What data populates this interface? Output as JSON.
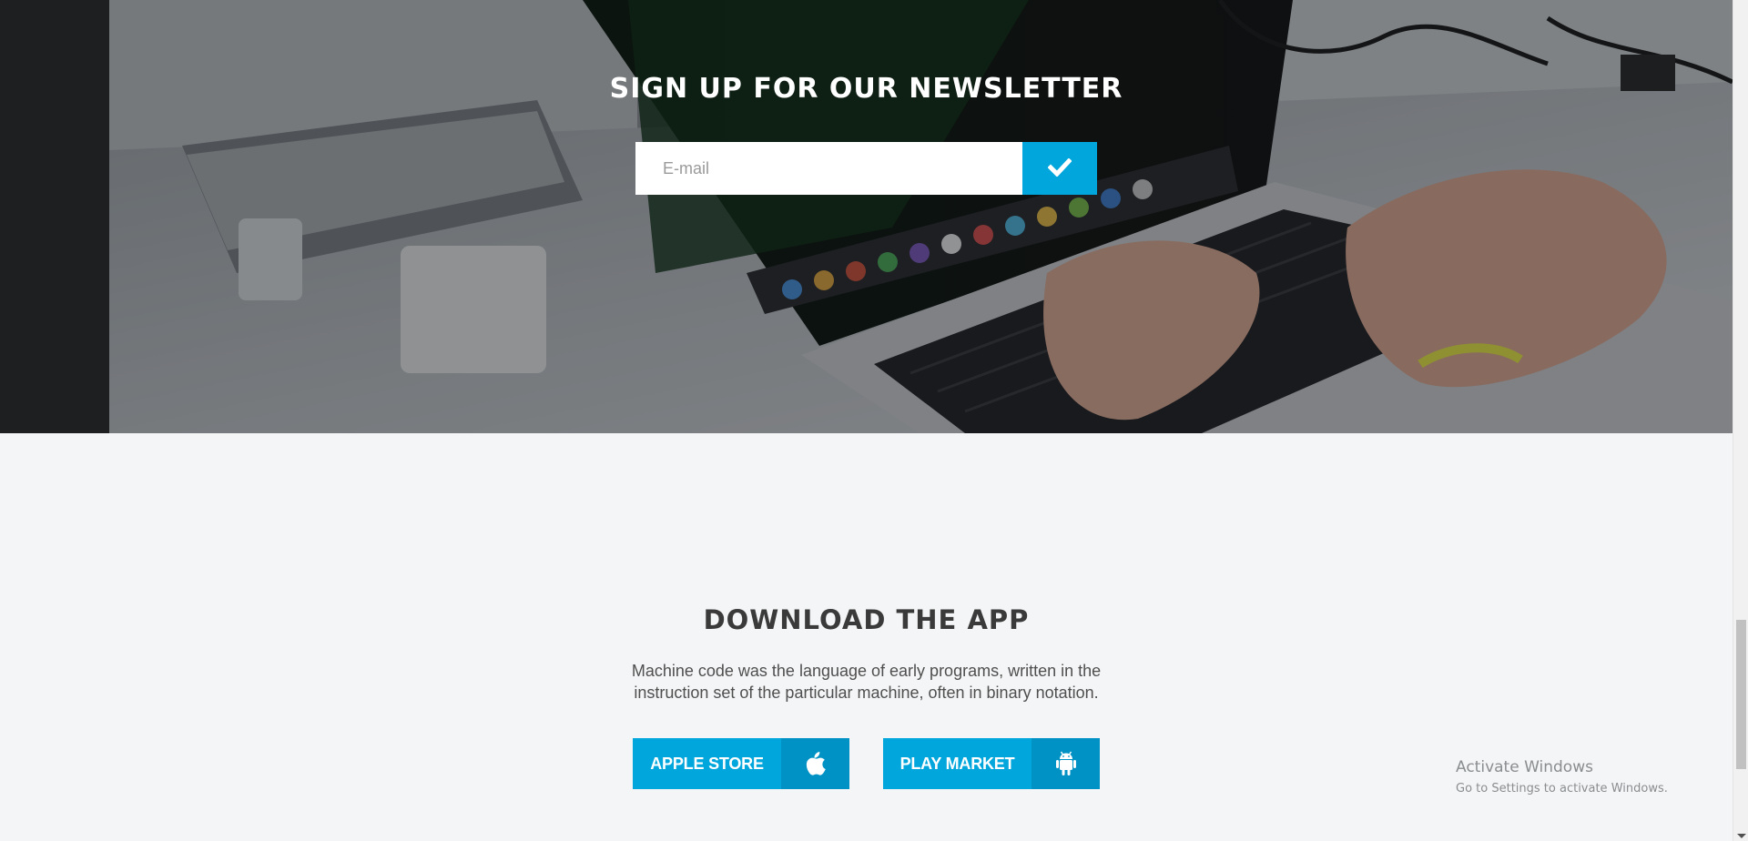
{
  "newsletter": {
    "title": "SIGN UP FOR OUR NEWSLETTER",
    "email_placeholder": "E-mail",
    "submit_icon": "check-icon",
    "background": "laptop-typing-photo"
  },
  "download": {
    "title": "DOWNLOAD THE APP",
    "description": "Machine code was the language of early programs, written in the instruction set of the particular machine, often in binary notation.",
    "buttons": [
      {
        "label": "APPLE STORE",
        "icon": "apple-icon"
      },
      {
        "label": "PLAY MARKET",
        "icon": "android-icon"
      }
    ]
  },
  "watermark": {
    "title": "Activate Windows",
    "subtitle": "Go to Settings to activate Windows."
  },
  "colors": {
    "accent": "#00a6dc",
    "accent_dark": "#0092c4",
    "section_background": "#f4f5f6",
    "heading_text": "#3a3a3a"
  }
}
